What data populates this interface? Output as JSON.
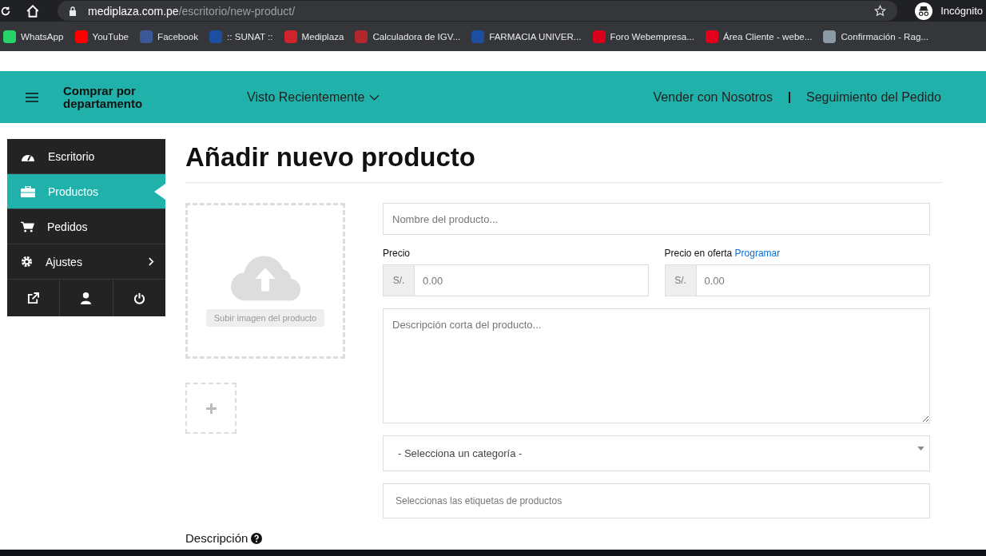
{
  "browser": {
    "url_host": "mediplaza.com.pe",
    "url_path": "/escritorio/new-product/",
    "profile": "Incógnito",
    "bookmarks": [
      {
        "label": "WhatsApp",
        "color": "#25d366"
      },
      {
        "label": "YouTube",
        "color": "#ff0000"
      },
      {
        "label": "Facebook",
        "color": "#3b5998"
      },
      {
        "label": ":: SUNAT ::",
        "color": "#1d4fa0"
      },
      {
        "label": "Mediplaza",
        "color": "#d0232a"
      },
      {
        "label": "Calculadora de IGV...",
        "color": "#b3282d"
      },
      {
        "label": "FARMACIA UNIVER...",
        "color": "#1d4fa0"
      },
      {
        "label": "Foro Webempresa...",
        "color": "#d9001b"
      },
      {
        "label": "Área Cliente - webe...",
        "color": "#e2001a"
      },
      {
        "label": "Confirmación - Rag...",
        "color": "#8a9aa6"
      }
    ]
  },
  "header": {
    "department": "Comprar por departamento",
    "recent": "Visto Recientemente",
    "links": [
      "Vender con Nosotros",
      "Seguimiento del Pedido"
    ]
  },
  "sidebar": {
    "items": [
      {
        "label": "Escritorio",
        "selected": false,
        "has_submenu": false
      },
      {
        "label": "Productos",
        "selected": true,
        "has_submenu": false
      },
      {
        "label": "Pedidos",
        "selected": false,
        "has_submenu": false
      },
      {
        "label": "Ajustes",
        "selected": false,
        "has_submenu": true
      }
    ]
  },
  "page": {
    "title": "Añadir nuevo producto",
    "upload_label": "Subir imagen del producto",
    "name_placeholder": "Nombre del producto...",
    "price": {
      "label": "Precio",
      "currency": "S/.",
      "placeholder": "0.00"
    },
    "sale_price": {
      "label": "Precio en oferta",
      "link": "Programar",
      "currency": "S/.",
      "placeholder": "0.00"
    },
    "short_description_placeholder": "Descripción corta del producto...",
    "category": "- Selecciona un categoría -",
    "tags_placeholder": "Seleccionas las etiquetas de productos",
    "description_label": "Descripción"
  }
}
